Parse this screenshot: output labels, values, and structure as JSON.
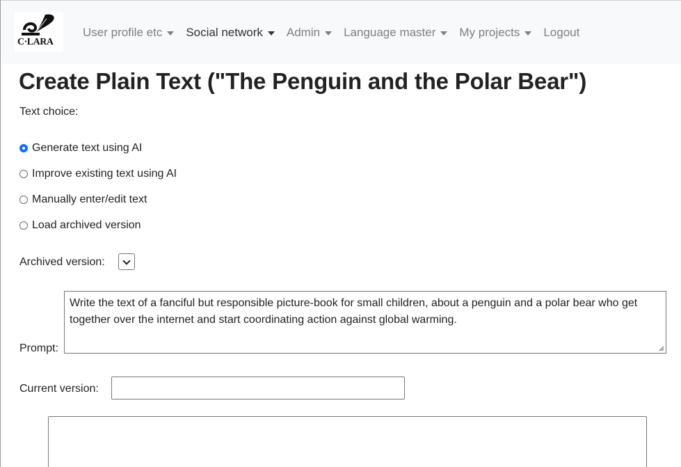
{
  "navbar": {
    "logo_text": "C·LARA",
    "items": [
      {
        "label": "User profile etc",
        "dropdown": true,
        "active": false
      },
      {
        "label": "Social network",
        "dropdown": true,
        "active": true
      },
      {
        "label": "Admin",
        "dropdown": true,
        "active": false
      },
      {
        "label": "Language master",
        "dropdown": true,
        "active": false
      },
      {
        "label": "My projects",
        "dropdown": true,
        "active": false
      },
      {
        "label": "Logout",
        "dropdown": false,
        "active": false
      }
    ]
  },
  "page": {
    "title": "Create Plain Text (\"The Penguin and the Polar Bear\")",
    "text_choice_label": "Text choice:",
    "options": [
      {
        "label": "Generate text using AI",
        "checked": true
      },
      {
        "label": "Improve existing text using AI",
        "checked": false
      },
      {
        "label": "Manually enter/edit text",
        "checked": false
      },
      {
        "label": "Load archived version",
        "checked": false
      }
    ],
    "archived_version_label": "Archived version:",
    "archived_version_value": "",
    "prompt_label": "Prompt:",
    "prompt_text": "Write the text of a fanciful but responsible picture-book for small children, about a penguin and a polar bear who get together over the internet and start coordinating action against global warming.",
    "current_version_label": "Current version:",
    "current_version_value": "",
    "text_area_value": ""
  },
  "colors": {
    "navbar_bg": "#f8f9fa",
    "nav_inactive": "#7d8086",
    "nav_active": "#2f3338",
    "radio_accent": "#0d6efd"
  }
}
